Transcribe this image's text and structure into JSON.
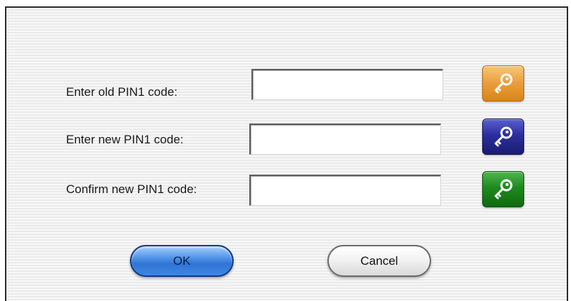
{
  "dialog": {
    "rows": [
      {
        "label": "Enter old PIN1 code:",
        "value": "",
        "icon": "key-icon",
        "icon_color": "#e8982e"
      },
      {
        "label": "Enter new PIN1 code:",
        "value": "",
        "icon": "key-icon",
        "icon_color": "#24278f"
      },
      {
        "label": "Confirm new PIN1 code:",
        "value": "",
        "icon": "key-icon",
        "icon_color": "#1a7f1a"
      }
    ],
    "buttons": {
      "ok_label": "OK",
      "cancel_label": "Cancel"
    }
  },
  "colors": {
    "ok_button": "#3f86e2",
    "cancel_button": "#eeeeee",
    "dialog_border": "#2b2b2b"
  }
}
